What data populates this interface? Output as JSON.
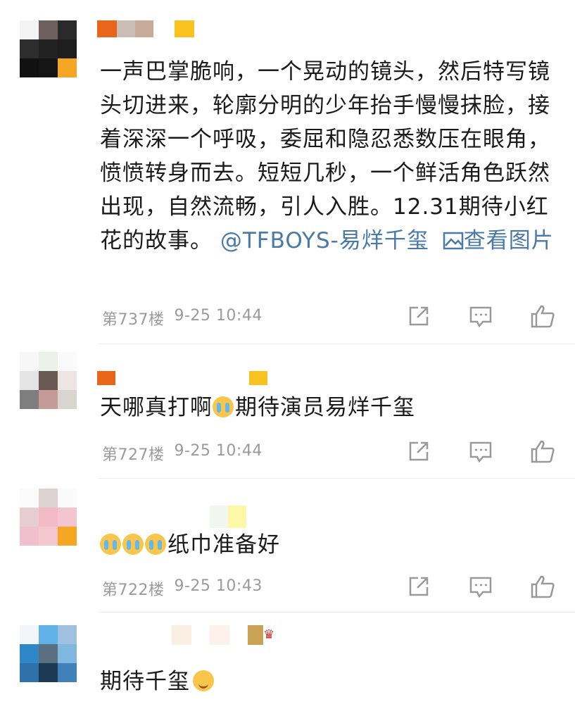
{
  "comments": [
    {
      "text": "一声巴掌脆响，一个晃动的镜头，然后特写镜头切进来，轮廓分明的少年抬手慢慢抹脸，接着深深一个呼吸，委屈和隐忍悉数压在眼角，愤愤转身而去。短短几秒，一个鲜活角色跃然出现，自然流畅，引人入胜。12.31期待小红花的故事。",
      "mention": "@TFBOYS-易烊千玺",
      "view_image": "查看图片",
      "floor": "第737楼",
      "time": "9-25 10:44"
    },
    {
      "prefix": "天哪真打啊",
      "text": "期待演员易烊千玺",
      "floor": "第727楼",
      "time": "9-25 10:44"
    },
    {
      "text": "纸巾准备好",
      "floor": "第722楼",
      "time": "9-25 10:43"
    },
    {
      "text": "期待千玺"
    }
  ],
  "icons": {
    "share": "share-icon",
    "reply": "comment-icon",
    "like": "like-icon",
    "image": "image-icon",
    "emoji_cry": "crying-face-emoji",
    "emoji_smile": "smiling-face-emoji"
  },
  "colors": {
    "link": "#4a79a8",
    "meta": "#9a9a9a",
    "text": "#1a1a1a"
  }
}
